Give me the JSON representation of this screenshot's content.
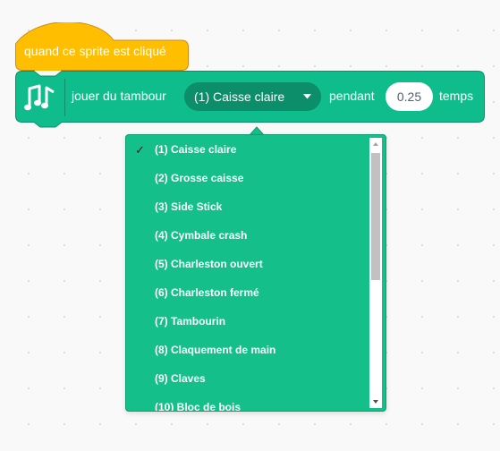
{
  "hat_block": {
    "label": "quand ce sprite est cliqué",
    "color": "#ffab19",
    "border_color": "#cf8b17"
  },
  "command_block": {
    "icon": "music-notes-icon",
    "text_before": "jouer du tambour",
    "dropdown_value": "(1) Caisse claire",
    "text_middle": "pendant",
    "beats_value": "0.25",
    "text_after": "temps",
    "color": "#0fbd8c",
    "border_color": "#0b8e69"
  },
  "dropdown_menu": {
    "selected_index": 0,
    "check_mark": "✓",
    "scroll_fraction": 0.0,
    "items": [
      "(1) Caisse claire",
      "(2) Grosse caisse",
      "(3) Side Stick",
      "(4) Cymbale crash",
      "(5) Charleston ouvert",
      "(6) Charleston fermé",
      "(7) Tambourin",
      "(8) Claquement de main",
      "(9) Claves",
      "(10) Bloc de bois"
    ]
  }
}
